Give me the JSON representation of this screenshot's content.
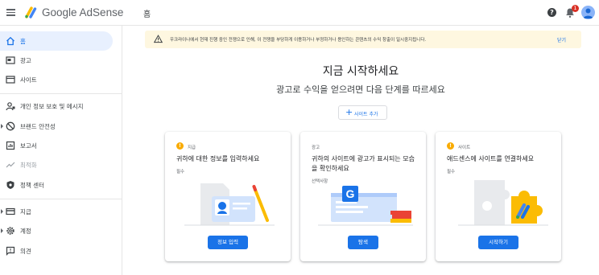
{
  "header": {
    "menu_icon": "menu-icon",
    "logo_icon": "adsense-logo-icon",
    "brand": "Google AdSense",
    "page_title": "홈",
    "help_icon": "help-icon",
    "notifications_icon": "bell-icon",
    "notification_count": "1",
    "avatar_icon": "avatar-icon"
  },
  "sidebar": {
    "items": [
      {
        "label": "홈",
        "icon": "home-icon",
        "active": true
      },
      {
        "label": "광고",
        "icon": "ads-icon"
      },
      {
        "label": "사이트",
        "icon": "sites-icon"
      },
      {
        "label": "개인 정보 보호 및 메시지",
        "icon": "privacy-icon"
      },
      {
        "label": "브랜드 안전성",
        "icon": "block-icon",
        "expandable": true
      },
      {
        "label": "보고서",
        "icon": "reports-icon"
      },
      {
        "label": "최적화",
        "icon": "trending-icon",
        "disabled": true
      },
      {
        "label": "정책 센터",
        "icon": "policy-icon"
      },
      {
        "label": "지급",
        "icon": "payments-icon",
        "expandable": true
      },
      {
        "label": "계정",
        "icon": "gear-icon",
        "expandable": true
      },
      {
        "label": "의견",
        "icon": "feedback-icon"
      }
    ]
  },
  "banner": {
    "icon": "warning-icon",
    "message": "우크라이나에서 현재 진행 중인 전쟁으로 인해, 이 전쟁을 부당하게 이용하거나 부정하거나 용인하는 콘텐츠의 수익 창출이 일시중지됩니다.",
    "close_label": "닫기"
  },
  "main": {
    "title": "지금 시작하세요",
    "subtitle": "광고로 수익을 얻으려면 다음 단계를 따르세요",
    "add_site_label": "사이트 추가"
  },
  "cards": [
    {
      "tag": "지급",
      "title": "귀하에 대한 정보를 입력하세요",
      "note": "필수",
      "button": "정보 입력",
      "tag_icon": "alert-icon"
    },
    {
      "tag": "광고",
      "title": "귀하의 사이트에 광고가 표시되는 모습을 확인하세요",
      "note": "선택사항",
      "button": "탐색",
      "tag_icon": ""
    },
    {
      "tag": "사이트",
      "title": "애드센스에 사이트를 연결하세요",
      "note": "필수",
      "button": "시작하기",
      "tag_icon": "alert-icon"
    }
  ],
  "colors": {
    "accent": "#1a73e8",
    "warning": "#f9ab00",
    "banner_bg": "#fef7e0",
    "badge": "#d93025"
  }
}
